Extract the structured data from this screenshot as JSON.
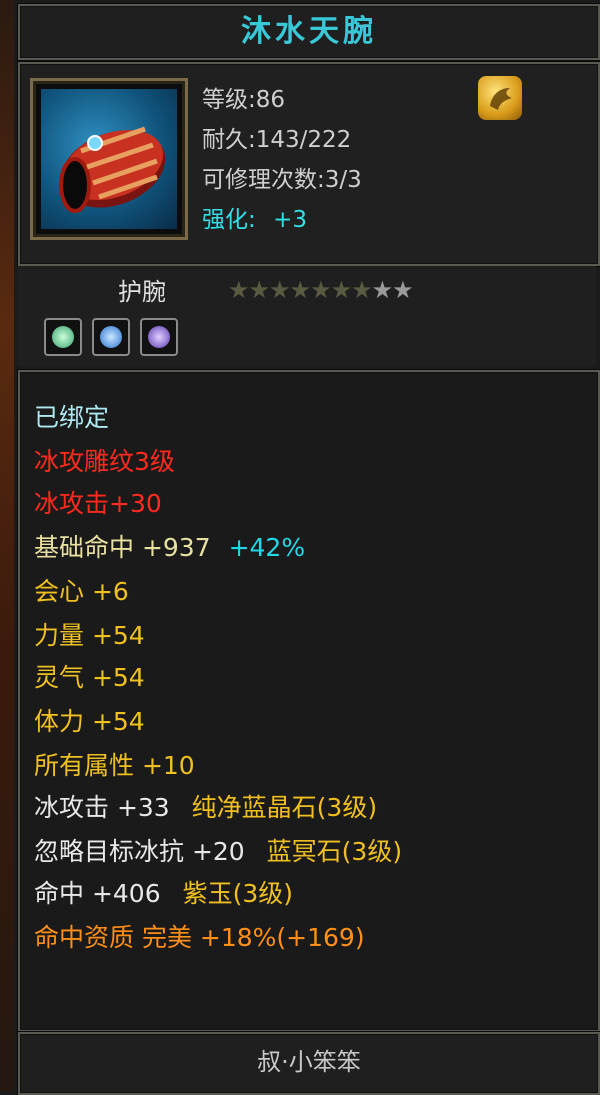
{
  "item": {
    "name": "沐水天腕",
    "level_label": "等级:86",
    "durability_label": "耐久:143/222",
    "repair_label": "可修理次数:3/3",
    "enhance_label": "强化:",
    "enhance_value": "+3",
    "type": "护腕",
    "stars": {
      "filled": 7,
      "total": 9
    },
    "gems": [
      "green-gem-icon",
      "blue-gem-icon",
      "purple-gem-icon"
    ],
    "colors": {
      "title": "#39c8d8",
      "red": "#ff2a1e",
      "yellow": "#f0c020",
      "cyan": "#22d8e8",
      "orange": "#ff8f18"
    }
  },
  "attributes": {
    "bound": "已绑定",
    "engrave": "冰攻雕纹3级",
    "ice_attack": "冰攻击+30",
    "base_hit": "基础命中 +937",
    "base_hit_pct": "+42%",
    "crit": "会心 +6",
    "strength": "力量 +54",
    "spirit": "灵气 +54",
    "stamina": "体力 +54",
    "all_attr": "所有属性 +10",
    "gem1_stat": "冰攻击 +33",
    "gem1_name": "纯净蓝晶石(3级)",
    "gem2_stat": "忽略目标冰抗 +20",
    "gem2_name": "蓝冥石(3级)",
    "gem3_stat": "命中 +406",
    "gem3_name": "紫玉(3级)",
    "quality": "命中资质  完美 +18%(+169)"
  },
  "owner": "叔·小笨笨"
}
